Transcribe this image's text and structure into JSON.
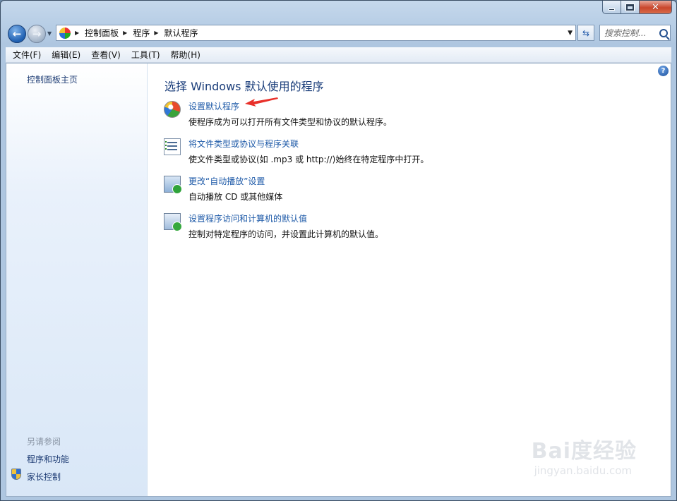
{
  "address": {
    "crumbs": [
      "控制面板",
      "程序",
      "默认程序"
    ]
  },
  "search": {
    "placeholder": "搜索控制..."
  },
  "menu": [
    "文件(F)",
    "编辑(E)",
    "查看(V)",
    "工具(T)",
    "帮助(H)"
  ],
  "sidebar": {
    "home": "控制面板主页",
    "see_also": "另请参阅",
    "links": [
      "程序和功能",
      "家长控制"
    ]
  },
  "main": {
    "title": "选择 Windows 默认使用的程序",
    "tasks": [
      {
        "link": "设置默认程序",
        "desc": "使程序成为可以打开所有文件类型和协议的默认程序。",
        "icon": "default-programs-icon"
      },
      {
        "link": "将文件类型或协议与程序关联",
        "desc": "使文件类型或协议(如 .mp3 或 http://)始终在特定程序中打开。",
        "icon": "file-association-icon"
      },
      {
        "link": "更改“自动播放”设置",
        "desc": "自动播放 CD 或其他媒体",
        "icon": "autoplay-icon"
      },
      {
        "link": "设置程序访问和计算机的默认值",
        "desc": "控制对特定程序的访问，并设置此计算机的默认值。",
        "icon": "program-access-icon"
      }
    ]
  },
  "watermark": {
    "logo": "Bai度经验",
    "url": "jingyan.baidu.com"
  },
  "colors": {
    "link": "#1e5aa8",
    "title": "#1a3d7a",
    "arrow": "#e8302a"
  }
}
